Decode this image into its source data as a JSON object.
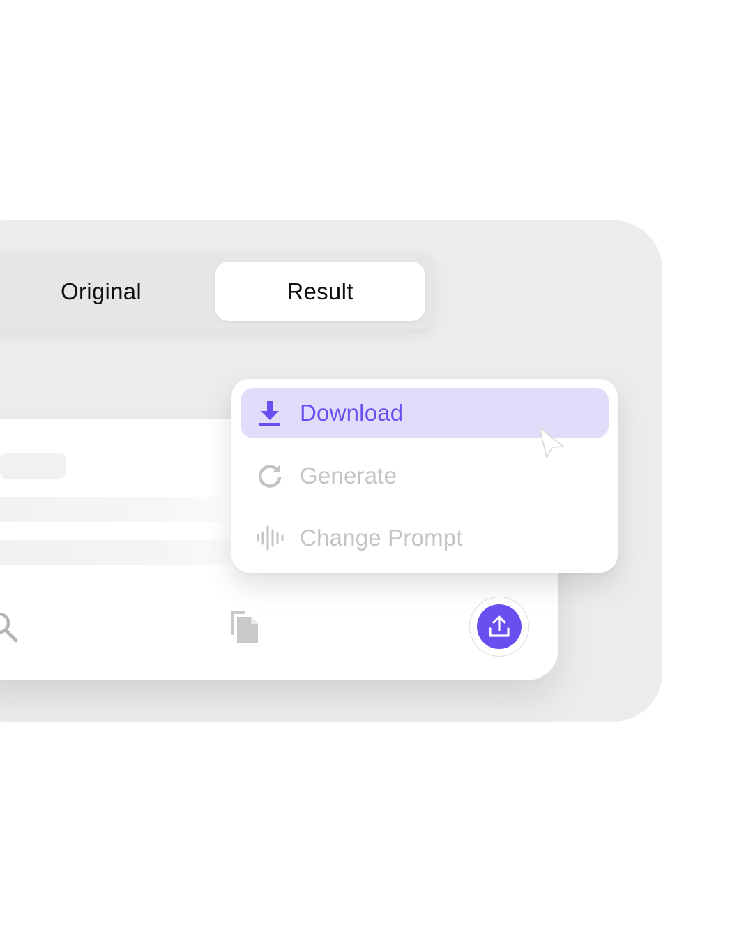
{
  "tabs": {
    "original_label": "Original",
    "result_label": "Result",
    "selected": "Result"
  },
  "menu": {
    "items": [
      {
        "label": "Download",
        "icon": "download-icon",
        "active": true
      },
      {
        "label": "Generate",
        "icon": "refresh-icon",
        "active": false
      },
      {
        "label": "Change Prompt",
        "icon": "audio-wave-icon",
        "active": false
      }
    ]
  },
  "toolbar": {
    "icons": [
      "search-icon",
      "copy-icon",
      "upload-icon"
    ]
  },
  "colors": {
    "accent": "#6a4ff0",
    "highlight": "#e2dcfb",
    "muted_text": "#c4c4c4",
    "panel_bg": "#ececec"
  }
}
